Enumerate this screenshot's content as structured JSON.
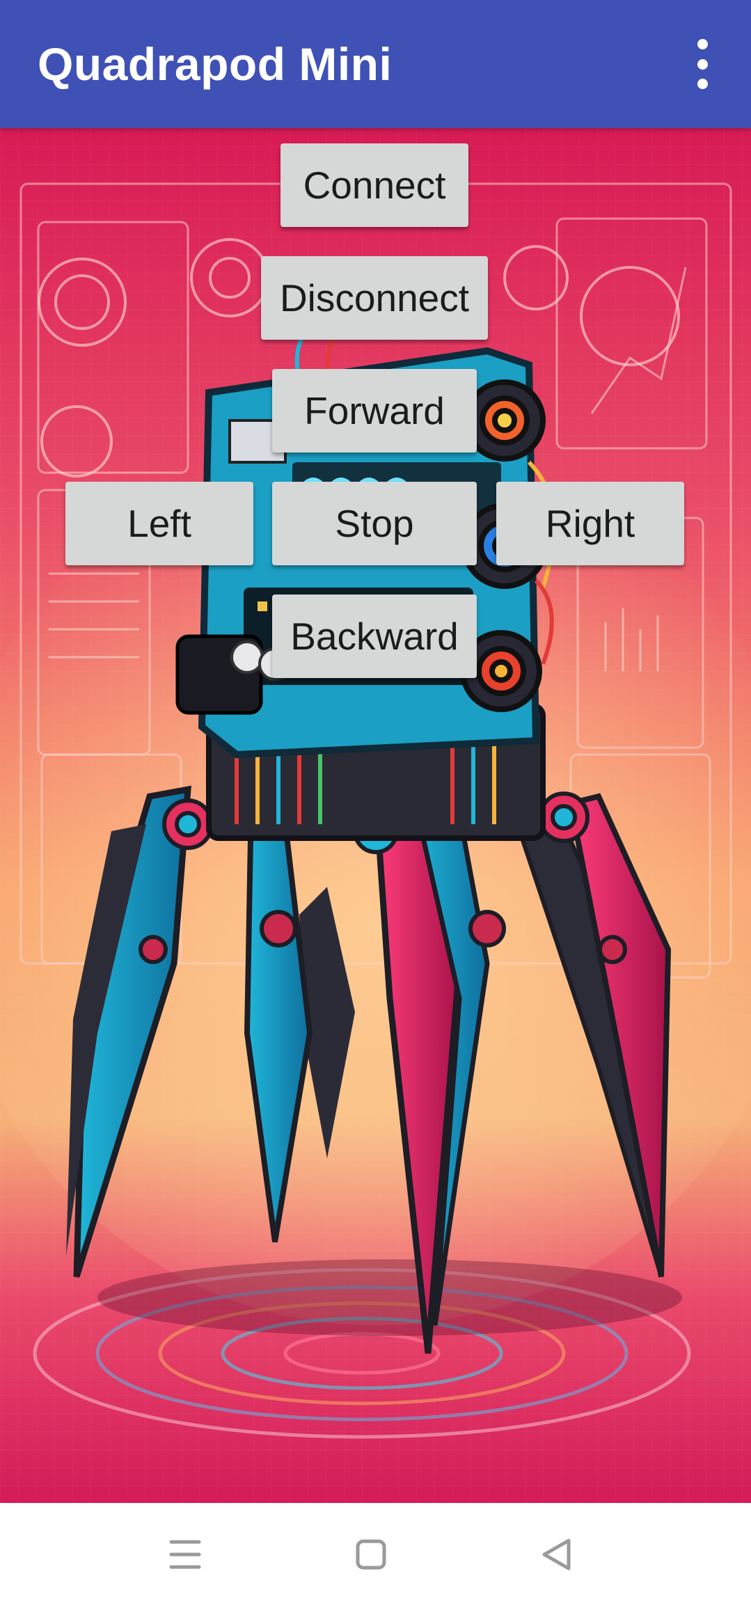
{
  "app_bar": {
    "title": "Quadrapod Mini",
    "menu_icon": "more-vert-icon",
    "background_color": "#3f51b5"
  },
  "background": {
    "subject": "robot-quadruped-illustration",
    "accent_colors": [
      "#d81e5b",
      "#f7b26a",
      "#1fb6d8"
    ]
  },
  "controls": {
    "connect": "Connect",
    "disconnect": "Disconnect",
    "forward": "Forward",
    "left": "Left",
    "stop": "Stop",
    "right": "Right",
    "backward": "Backward"
  },
  "nav_bar": {
    "recents_icon": "menu-lines-icon",
    "home_icon": "square-home-icon",
    "back_icon": "triangle-back-icon"
  }
}
